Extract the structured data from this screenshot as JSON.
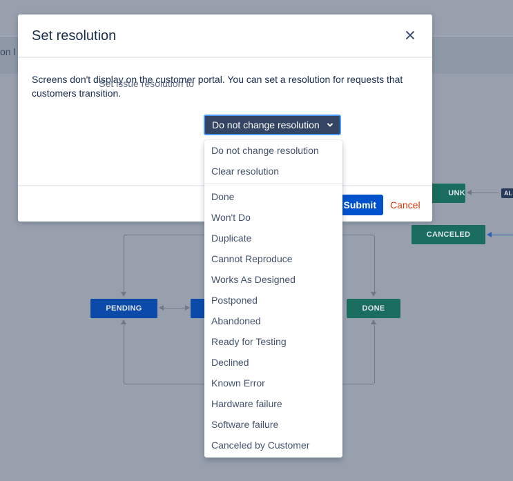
{
  "background": {
    "top_band_text": "on l",
    "all_badge": "AL",
    "statuses": {
      "pending": "PENDING",
      "done": "DONE",
      "canceled": "CANCELED",
      "unk": "UNK"
    },
    "colors": {
      "blue_status": "#0b4aa8",
      "green_status": "#1a6c5e"
    }
  },
  "modal": {
    "title": "Set resolution",
    "description": "Screens don't display on the customer portal. You can set a resolution for requests that customers transition.",
    "field_label": "Set issue resolution to",
    "selected_value": "Do not change resolution",
    "submit_label": "Submit",
    "cancel_label": "Cancel",
    "icons": {
      "close": "close-icon",
      "chevron": "chevron-down-icon"
    }
  },
  "dropdown": {
    "group1": [
      "Do not change resolution",
      "Clear resolution"
    ],
    "group2": [
      "Done",
      "Won't Do",
      "Duplicate",
      "Cannot Reproduce",
      "Works As Designed",
      "Postponed",
      "Abandoned",
      "Ready for Testing",
      "Declined",
      "Known Error",
      "Hardware failure",
      "Software failure",
      "Canceled by Customer"
    ]
  },
  "colors": {
    "primary": "#0052cc",
    "select_bg": "#344563",
    "focus_ring": "#4c9aff",
    "cancel": "#de350b"
  }
}
